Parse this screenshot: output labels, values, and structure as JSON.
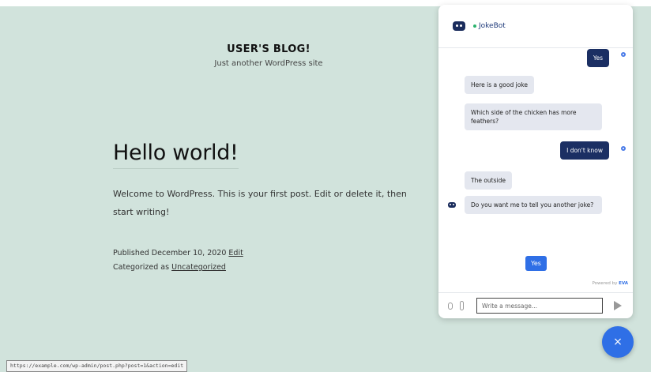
{
  "site": {
    "title": "USER'S BLOG!",
    "tagline": "Just another WordPress site"
  },
  "post": {
    "title": "Hello world!",
    "content": "Welcome to WordPress. This is your first post. Edit or delete it, then start writing!",
    "published_prefix": "Published",
    "published_date": "December 10, 2020",
    "edit_link": "Edit",
    "categorized_prefix": "Categorized as",
    "category": "Uncategorized"
  },
  "status_bar": {
    "url": "https://example.com/wp-admin/post.php?post=1&action=edit"
  },
  "chat": {
    "bot_name": "JokeBot",
    "messages": [
      {
        "from": "user",
        "text": "Yes"
      },
      {
        "from": "bot",
        "text": "Here is a good joke"
      },
      {
        "from": "bot",
        "text": "Which side of the chicken has more feathers?"
      },
      {
        "from": "user",
        "text": "I don't know"
      },
      {
        "from": "bot",
        "text": "The outside"
      },
      {
        "from": "bot",
        "text": "Do you want me to tell you another joke?"
      }
    ],
    "quick_reply": "Yes",
    "powered_by_prefix": "Powered by",
    "powered_by_brand": "EVA",
    "input_placeholder": "Write a message..."
  },
  "fab": {
    "label": "×"
  },
  "colors": {
    "page_bg": "#d1e3dc",
    "accent": "#2f6fe6",
    "user_bubble": "#1b2f63",
    "bot_bubble": "#e4e7ef"
  }
}
